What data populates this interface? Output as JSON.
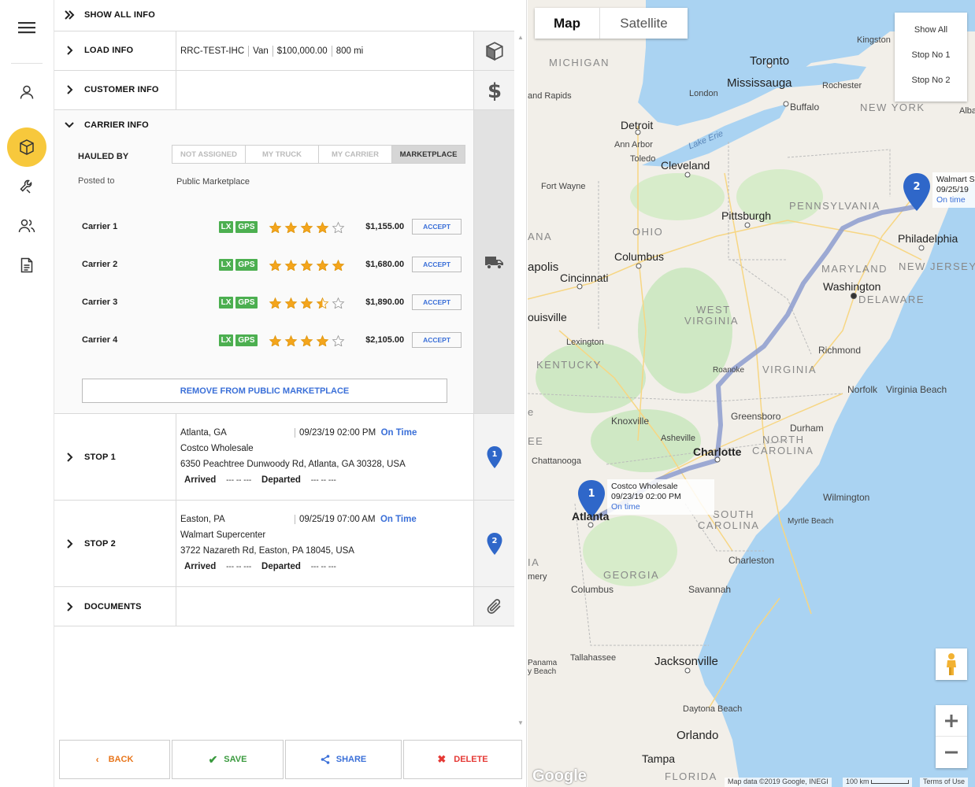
{
  "panel": {
    "show_all": "SHOW ALL INFO",
    "load_info": {
      "label": "LOAD INFO",
      "ref": "RRC-TEST-IHC",
      "equipment": "Van",
      "value": "$100,000.00",
      "distance": "800 mi"
    },
    "customer_info": {
      "label": "CUSTOMER INFO"
    },
    "carrier_info": {
      "label": "CARRIER INFO",
      "hauled_by_label": "HAULED BY",
      "options": [
        "NOT ASSIGNED",
        "MY TRUCK",
        "MY CARRIER",
        "MARKETPLACE"
      ],
      "selected_option": "MARKETPLACE",
      "posted_to_label": "Posted to",
      "posted_to_value": "Public Marketplace",
      "carriers": [
        {
          "name": "Carrier 1",
          "badges": [
            "LX",
            "GPS"
          ],
          "rating": 4,
          "price": "$1,155.00",
          "action": "ACCEPT"
        },
        {
          "name": "Carrier 2",
          "badges": [
            "LX",
            "GPS"
          ],
          "rating": 5,
          "price": "$1,680.00",
          "action": "ACCEPT"
        },
        {
          "name": "Carrier 3",
          "badges": [
            "LX",
            "GPS"
          ],
          "rating": 3.5,
          "price": "$1,890.00",
          "action": "ACCEPT"
        },
        {
          "name": "Carrier 4",
          "badges": [
            "LX",
            "GPS"
          ],
          "rating": 4,
          "price": "$2,105.00",
          "action": "ACCEPT"
        }
      ],
      "remove_button": "REMOVE FROM PUBLIC MARKETPLACE"
    },
    "stops": [
      {
        "label": "STOP 1",
        "marker": "1",
        "city": "Atlanta, GA",
        "datetime": "09/23/19 02:00 PM",
        "status": "On Time",
        "facility": "Costco Wholesale",
        "address": "6350 Peachtree Dunwoody Rd, Atlanta, GA 30328, USA",
        "arrived_label": "Arrived",
        "arrived_value": "--- -- ---",
        "departed_label": "Departed",
        "departed_value": "--- -- ---"
      },
      {
        "label": "STOP 2",
        "marker": "2",
        "city": "Easton, PA",
        "datetime": "09/25/19 07:00 AM",
        "status": "On Time",
        "facility": "Walmart Supercenter",
        "address": "3722 Nazareth Rd, Easton, PA 18045, USA",
        "arrived_label": "Arrived",
        "arrived_value": "--- -- ---",
        "departed_label": "Departed",
        "departed_value": "--- -- ---"
      }
    ],
    "documents": {
      "label": "DOCUMENTS"
    },
    "actions": {
      "back": "BACK",
      "save": "SAVE",
      "share": "SHARE",
      "delete": "DELETE"
    }
  },
  "map": {
    "type_map": "Map",
    "type_satellite": "Satellite",
    "stop_controls": [
      "Show All",
      "Stop No 1",
      "Stop No 2"
    ],
    "info1": {
      "name": "Costco Wholesale",
      "datetime": "09/23/19 02:00 PM",
      "status": "On time"
    },
    "info2": {
      "name": "Walmart S",
      "datetime": "09/25/19",
      "status": "On time"
    },
    "labels": {
      "michigan": "MICHIGAN",
      "toronto": "Toronto",
      "kingston": "Kingston",
      "mississauga": "Mississauga",
      "rochester": "Rochester",
      "london": "London",
      "buffalo": "Buffalo",
      "newyork": "NEW YORK",
      "alba": "Alba",
      "grandrapids": "and Rapids",
      "detroit": "Detroit",
      "annarbor": "Ann Arbor",
      "lakeerie": "Lake Erie",
      "toledo": "Toledo",
      "cleveland": "Cleveland",
      "fortwayne": "Fort Wayne",
      "pittsburgh": "Pittsburgh",
      "pennsylvania": "PENNSYLVANIA",
      "ohio": "OHIO",
      "ana": "ANA",
      "philadelphia": "Philadelphia",
      "columbus": "Columbus",
      "apolis": "apolis",
      "maryland": "MARYLAND",
      "newjersey": "NEW JERSEY",
      "cincinnati": "Cincinnati",
      "washington": "Washington",
      "delaware": "DELAWARE",
      "westvirginia1": "WEST",
      "westvirginia2": "VIRGINIA",
      "louisville": "ouisville",
      "lexington": "Lexington",
      "richmond": "Richmond",
      "kentucky": "KENTUCKY",
      "roanoke": "Roanoke",
      "virginia": "VIRGINIA",
      "norfolk": "Norfolk",
      "virginiabeach": "Virginia Beach",
      "greensboro": "Greensboro",
      "knoxville": "Knoxville",
      "durham": "Durham",
      "asheville": "Asheville",
      "northcarolina1": "NORTH",
      "northcarolina2": "CAROLINA",
      "ee": "EE",
      "chattanooga": "Chattanooga",
      "charlotte": "Charlotte",
      "atlanta": "Atlanta",
      "wilmington": "Wilmington",
      "southcarolina1": "SOUTH",
      "southcarolina2": "CAROLINA",
      "myrtle": "Myrtle Beach",
      "ia": "IA",
      "charleston": "Charleston",
      "mery": "mery",
      "georgia": "GEORGIA",
      "columbusga": "Columbus",
      "savannah": "Savannah",
      "tallahassee": "Tallahassee",
      "panama1": "Panama",
      "panama2": "y Beach",
      "jacksonville": "Jacksonville",
      "daytona": "Daytona Beach",
      "orlando": "Orlando",
      "tampa": "Tampa",
      "florida": "FLORIDA",
      "e": "e",
      "google": "Google"
    },
    "attribution": {
      "data": "Map data ©2019 Google, INEGI",
      "scale": "100 km",
      "terms": "Terms of Use"
    }
  }
}
